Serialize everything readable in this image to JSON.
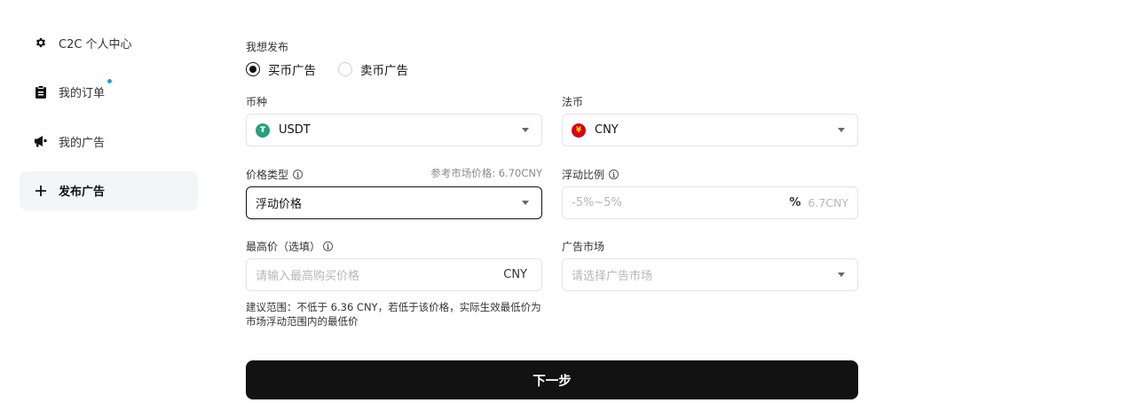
{
  "sidebar": {
    "items": [
      {
        "label": "C2C 个人中心",
        "icon": "gear-icon"
      },
      {
        "label": "我的订单",
        "icon": "clipboard-icon",
        "badge_color": "#19a9c4"
      },
      {
        "label": "我的广告",
        "icon": "megaphone-icon"
      },
      {
        "label": "发布广告",
        "icon": "plus-icon",
        "active": true
      }
    ]
  },
  "form": {
    "publish_label": "我想发布",
    "radio_options": [
      {
        "label": "买币广告",
        "checked": true
      },
      {
        "label": "卖币广告",
        "checked": false
      }
    ],
    "coin": {
      "label": "币种",
      "value": "USDT",
      "icon": "tether-icon",
      "icon_color": "#26a17b"
    },
    "fiat": {
      "label": "法币",
      "value": "CNY",
      "icon": "yuan-icon",
      "icon_color": "#d0021b"
    },
    "price_type": {
      "label": "价格类型",
      "ref_text": "参考市场价格: 6.70CNY",
      "value": "浮动价格"
    },
    "float_ratio": {
      "label": "浮动比例",
      "placeholder": "-5%~5%",
      "unit": "%",
      "preview": "6.7CNY"
    },
    "max_price": {
      "label": "最高价（选填）",
      "placeholder": "请输入最高购买价格",
      "unit": "CNY"
    },
    "ad_market": {
      "label": "广告市场",
      "placeholder": "请选择广告市场"
    },
    "hint": "建议范围：不低于 6.36 CNY，若低于该价格，实际生效最低价为市场浮动范围内的最低价",
    "next_button": "下一步"
  }
}
